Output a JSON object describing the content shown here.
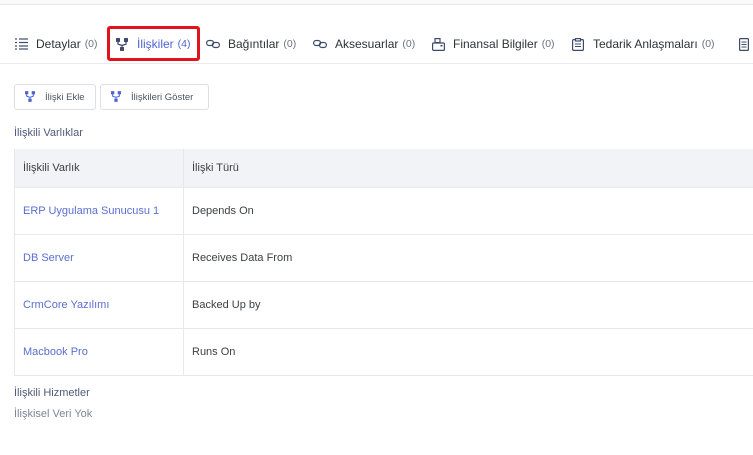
{
  "tabs": [
    {
      "label": "Detaylar",
      "count": "(0)",
      "icon": "list-icon"
    },
    {
      "label": "İlişkiler",
      "count": "(4)",
      "icon": "relation-icon"
    },
    {
      "label": "Bağıntılar",
      "count": "(0)",
      "icon": "link-icon"
    },
    {
      "label": "Aksesuarlar",
      "count": "(0)",
      "icon": "link-icon"
    },
    {
      "label": "Finansal Bilgiler",
      "count": "(0)",
      "icon": "printer-icon"
    },
    {
      "label": "Tedarik Anlaşmaları",
      "count": "(0)",
      "icon": "clipboard-icon"
    }
  ],
  "active_tab": "İlişkiler",
  "buttons": {
    "add_relation": "İlişki Ekle",
    "show_relations": "İlişkileri Göster"
  },
  "related_assets": {
    "title": "İlişkili Varlıklar",
    "columns": [
      "İlişkili Varlık",
      "İlişki Türü"
    ],
    "rows": [
      {
        "asset": "ERP Uygulama Sunucusu 1",
        "type": "Depends On"
      },
      {
        "asset": "DB Server",
        "type": "Receives Data From"
      },
      {
        "asset": "CrmCore Yazılımı",
        "type": "Backed Up by"
      },
      {
        "asset": "Macbook Pro",
        "type": "Runs On"
      }
    ]
  },
  "related_services": {
    "title": "İlişkili Hizmetler",
    "empty_text": "İlişkisel Veri Yok"
  },
  "colors": {
    "accent": "#4c64d4",
    "highlight": "#e2141b",
    "link": "#5a6fd0"
  }
}
